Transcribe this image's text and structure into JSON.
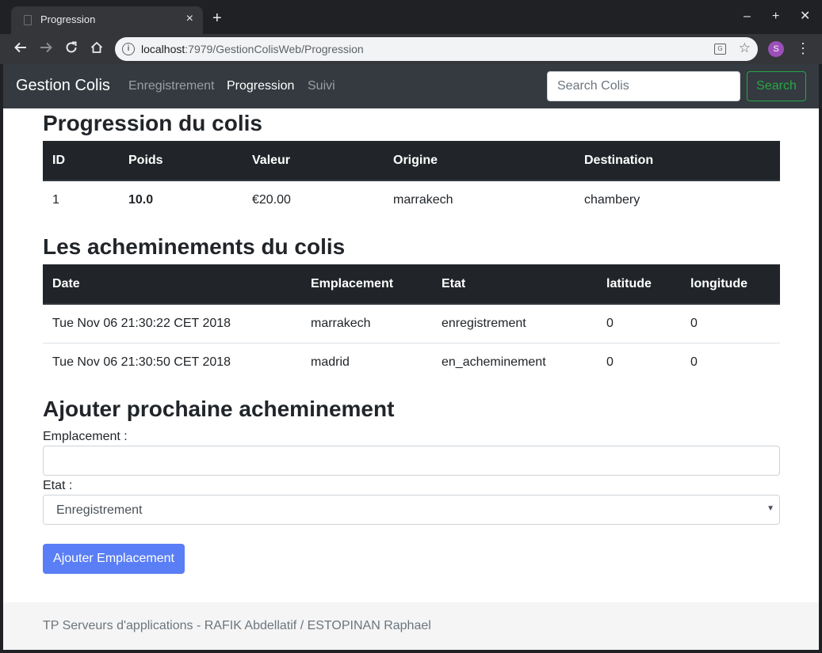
{
  "browser": {
    "tab_title": "Progression",
    "tab_close": "×",
    "new_tab": "+",
    "window_controls": {
      "minimize": "–",
      "maximize": "+",
      "close": "✕"
    },
    "url_host": "localhost",
    "url_rest": ":7979/GestionColisWeb/Progression",
    "profile_initial": "S",
    "icons": [
      "back-icon",
      "forward-icon",
      "reload-icon",
      "home-icon",
      "info-icon",
      "translate-icon",
      "star-icon",
      "menu-icon"
    ]
  },
  "navbar": {
    "brand": "Gestion Colis",
    "links": [
      {
        "label": "Enregistrement",
        "active": false
      },
      {
        "label": "Progression",
        "active": true
      },
      {
        "label": "Suivi",
        "active": false
      }
    ],
    "search_placeholder": "Search Colis",
    "search_button": "Search"
  },
  "parcel": {
    "heading": "Progression du colis",
    "columns": [
      "ID",
      "Poids",
      "Valeur",
      "Origine",
      "Destination"
    ],
    "row": {
      "id": "1",
      "poids": "10.0",
      "valeur": "€20.00",
      "origine": "marrakech",
      "destination": "chambery"
    }
  },
  "routing": {
    "heading": "Les acheminements du colis",
    "columns": [
      "Date",
      "Emplacement",
      "Etat",
      "latitude",
      "longitude"
    ],
    "rows": [
      {
        "date": "Tue Nov 06 21:30:22 CET 2018",
        "emplacement": "marrakech",
        "etat": "enregistrement",
        "latitude": "0",
        "longitude": "0"
      },
      {
        "date": "Tue Nov 06 21:30:50 CET 2018",
        "emplacement": "madrid",
        "etat": "en_acheminement",
        "latitude": "0",
        "longitude": "0"
      }
    ]
  },
  "form": {
    "heading": "Ajouter prochaine acheminement",
    "emplacement_label": "Emplacement :",
    "emplacement_value": "",
    "etat_label": "Etat :",
    "etat_selected": "Enregistrement",
    "submit_label": "Ajouter Emplacement"
  },
  "footer": {
    "text": "TP Serveurs d'applications - RAFIK Abdellatif / ESTOPINAN Raphael"
  },
  "colors": {
    "navbar_bg": "#343a40",
    "table_header_bg": "#212529",
    "search_button": "#28a745",
    "primary_button": "#5a7ef5"
  }
}
